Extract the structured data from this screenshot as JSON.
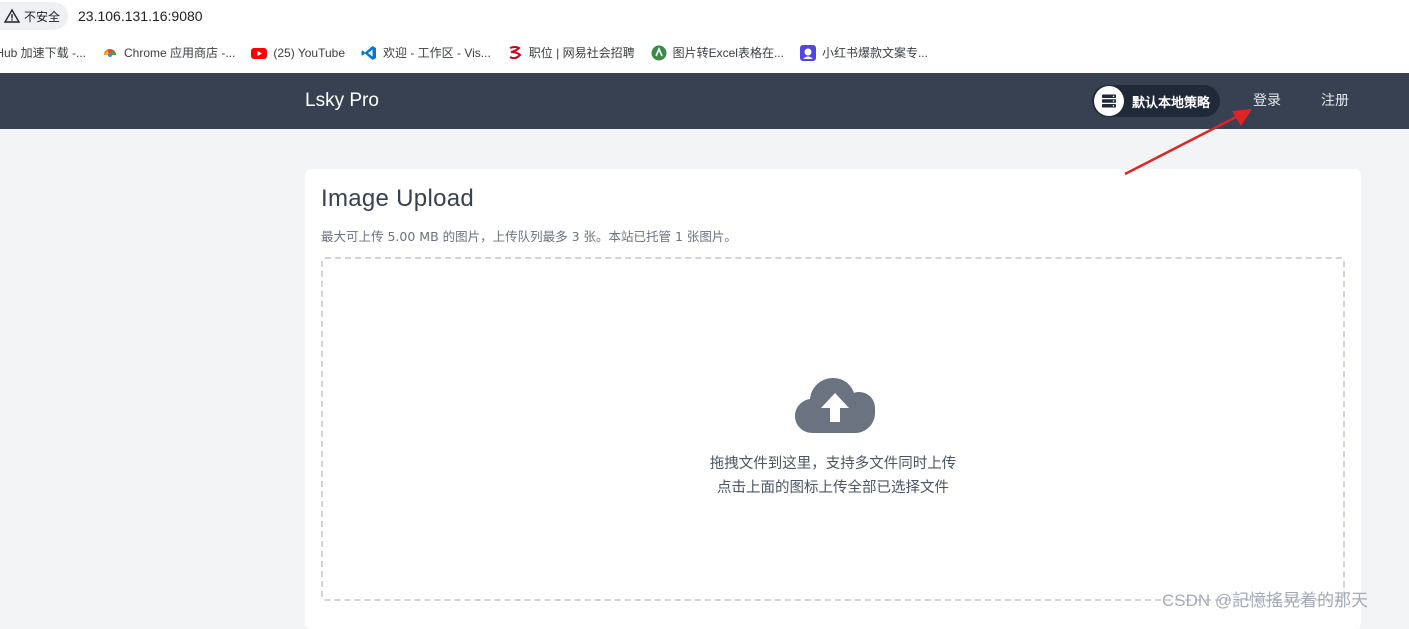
{
  "browser": {
    "security_label": "不安全",
    "url": "23.106.131.16:9080",
    "bookmarks": [
      {
        "label": "tHub 加速下载 -...",
        "icon": "github-accelerate-icon"
      },
      {
        "label": "Chrome 应用商店 -...",
        "icon": "chrome-webstore-icon"
      },
      {
        "label": "(25) YouTube",
        "icon": "youtube-icon"
      },
      {
        "label": "欢迎 - 工作区 - Vis...",
        "icon": "vscode-icon"
      },
      {
        "label": "职位 | 网易社会招聘",
        "icon": "netease-icon"
      },
      {
        "label": "图片转Excel表格在...",
        "icon": "image-to-excel-icon"
      },
      {
        "label": "小红书爆款文案专...",
        "icon": "xiaohongshu-icon"
      }
    ]
  },
  "navbar": {
    "brand": "Lsky Pro",
    "strategy_label": "默认本地策略",
    "login": "登录",
    "register": "注册"
  },
  "upload": {
    "title": "Image Upload",
    "subtitle": "最大可上传 5.00 MB 的图片，上传队列最多 3 张。本站已托管 1 张图片。",
    "drop_line1": "拖拽文件到这里，支持多文件同时上传",
    "drop_line2": "点击上面的图标上传全部已选择文件"
  },
  "watermark": "CSDN @記憶搖晃着的那天",
  "colors": {
    "navbar_bg": "#374151",
    "page_bg": "#f3f4f6",
    "annotation_arrow": "#e02424"
  }
}
